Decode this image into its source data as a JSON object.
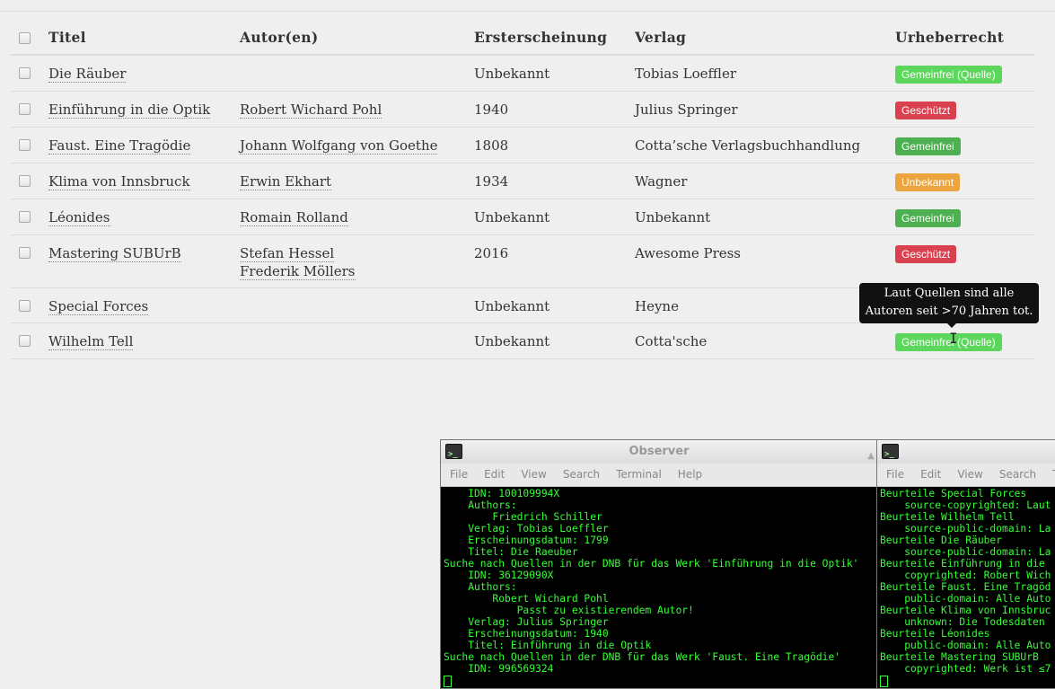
{
  "table": {
    "headers": [
      "Titel",
      "Autor(en)",
      "Ersterscheinung",
      "Verlag",
      "Urheberrecht"
    ],
    "rows": [
      {
        "title": "Die Räuber",
        "authors": [],
        "year": "Unbekannt",
        "publisher": "Tobias Loeffler",
        "copyright": "Gemeinfrei (Quelle)",
        "status": "gq"
      },
      {
        "title": "Einführung in die Optik",
        "authors": [
          "Robert Wichard Pohl"
        ],
        "year": "1940",
        "publisher": "Julius Springer",
        "copyright": "Geschützt",
        "status": "gs"
      },
      {
        "title": "Faust. Eine Tragödie",
        "authors": [
          "Johann Wolfgang von Goethe"
        ],
        "year": "1808",
        "publisher": "Cotta’sche Verlagsbuchhandlung",
        "copyright": "Gemeinfrei",
        "status": "gf"
      },
      {
        "title": "Klima von Innsbruck",
        "authors": [
          "Erwin Ekhart"
        ],
        "year": "1934",
        "publisher": "Wagner",
        "copyright": "Unbekannt",
        "status": "ub"
      },
      {
        "title": "Léonides",
        "authors": [
          "Romain Rolland"
        ],
        "year": "Unbekannt",
        "publisher": "Unbekannt",
        "copyright": "Gemeinfrei",
        "status": "gf"
      },
      {
        "title": "Mastering SUBUrB",
        "authors": [
          "Stefan Hessel",
          "Frederik Möllers"
        ],
        "year": "2016",
        "publisher": "Awesome Press",
        "copyright": "Geschützt",
        "status": "gs"
      },
      {
        "title": "Special Forces",
        "authors": [],
        "year": "Unbekannt",
        "publisher": "Heyne",
        "copyright": "",
        "status": ""
      },
      {
        "title": "Wilhelm Tell",
        "authors": [],
        "year": "Unbekannt",
        "publisher": "Cotta'sche",
        "copyright": "Gemeinfrei (Quelle)",
        "status": "gq"
      }
    ]
  },
  "tooltip": {
    "line1": "Laut Quellen sind alle",
    "line2": "Autoren seit >70 Jahren tot."
  },
  "terminal_left": {
    "title": "Observer",
    "menu": [
      "File",
      "Edit",
      "View",
      "Search",
      "Terminal",
      "Help"
    ],
    "lines": [
      "    IDN: 100109994X",
      "    Authors:",
      "        Friedrich Schiller",
      "    Verlag: Tobias Loeffler",
      "    Erscheinungsdatum: 1799",
      "    Titel: Die Raeuber",
      "Suche nach Quellen in der DNB für das Werk 'Einführung in die Optik'",
      "    IDN: 36129090X",
      "    Authors:",
      "        Robert Wichard Pohl",
      "            Passt zu existierendem Autor!",
      "    Verlag: Julius Springer",
      "    Erscheinungsdatum: 1940",
      "    Titel: Einführung in die Optik",
      "Suche nach Quellen in der DNB für das Werk 'Faust. Eine Tragödie'",
      "    IDN: 996569324"
    ]
  },
  "terminal_right": {
    "menu": [
      "File",
      "Edit",
      "View",
      "Search",
      "Terminal"
    ],
    "lines": [
      "Beurteile Special Forces",
      "    source-copyrighted: Laut",
      "Beurteile Wilhelm Tell",
      "    source-public-domain: La",
      "Beurteile Die Räuber",
      "    source-public-domain: La",
      "Beurteile Einführung in die",
      "    copyrighted: Robert Wich",
      "Beurteile Faust. Eine Tragöd",
      "    public-domain: Alle Auto",
      "Beurteile Klima von Innsbruc",
      "    unknown: Die Todesdaten",
      "Beurteile Léonides",
      "    public-domain: Alle Auto",
      "Beurteile Mastering SUBUrB",
      "    copyrighted: Werk ist ≤7"
    ]
  }
}
